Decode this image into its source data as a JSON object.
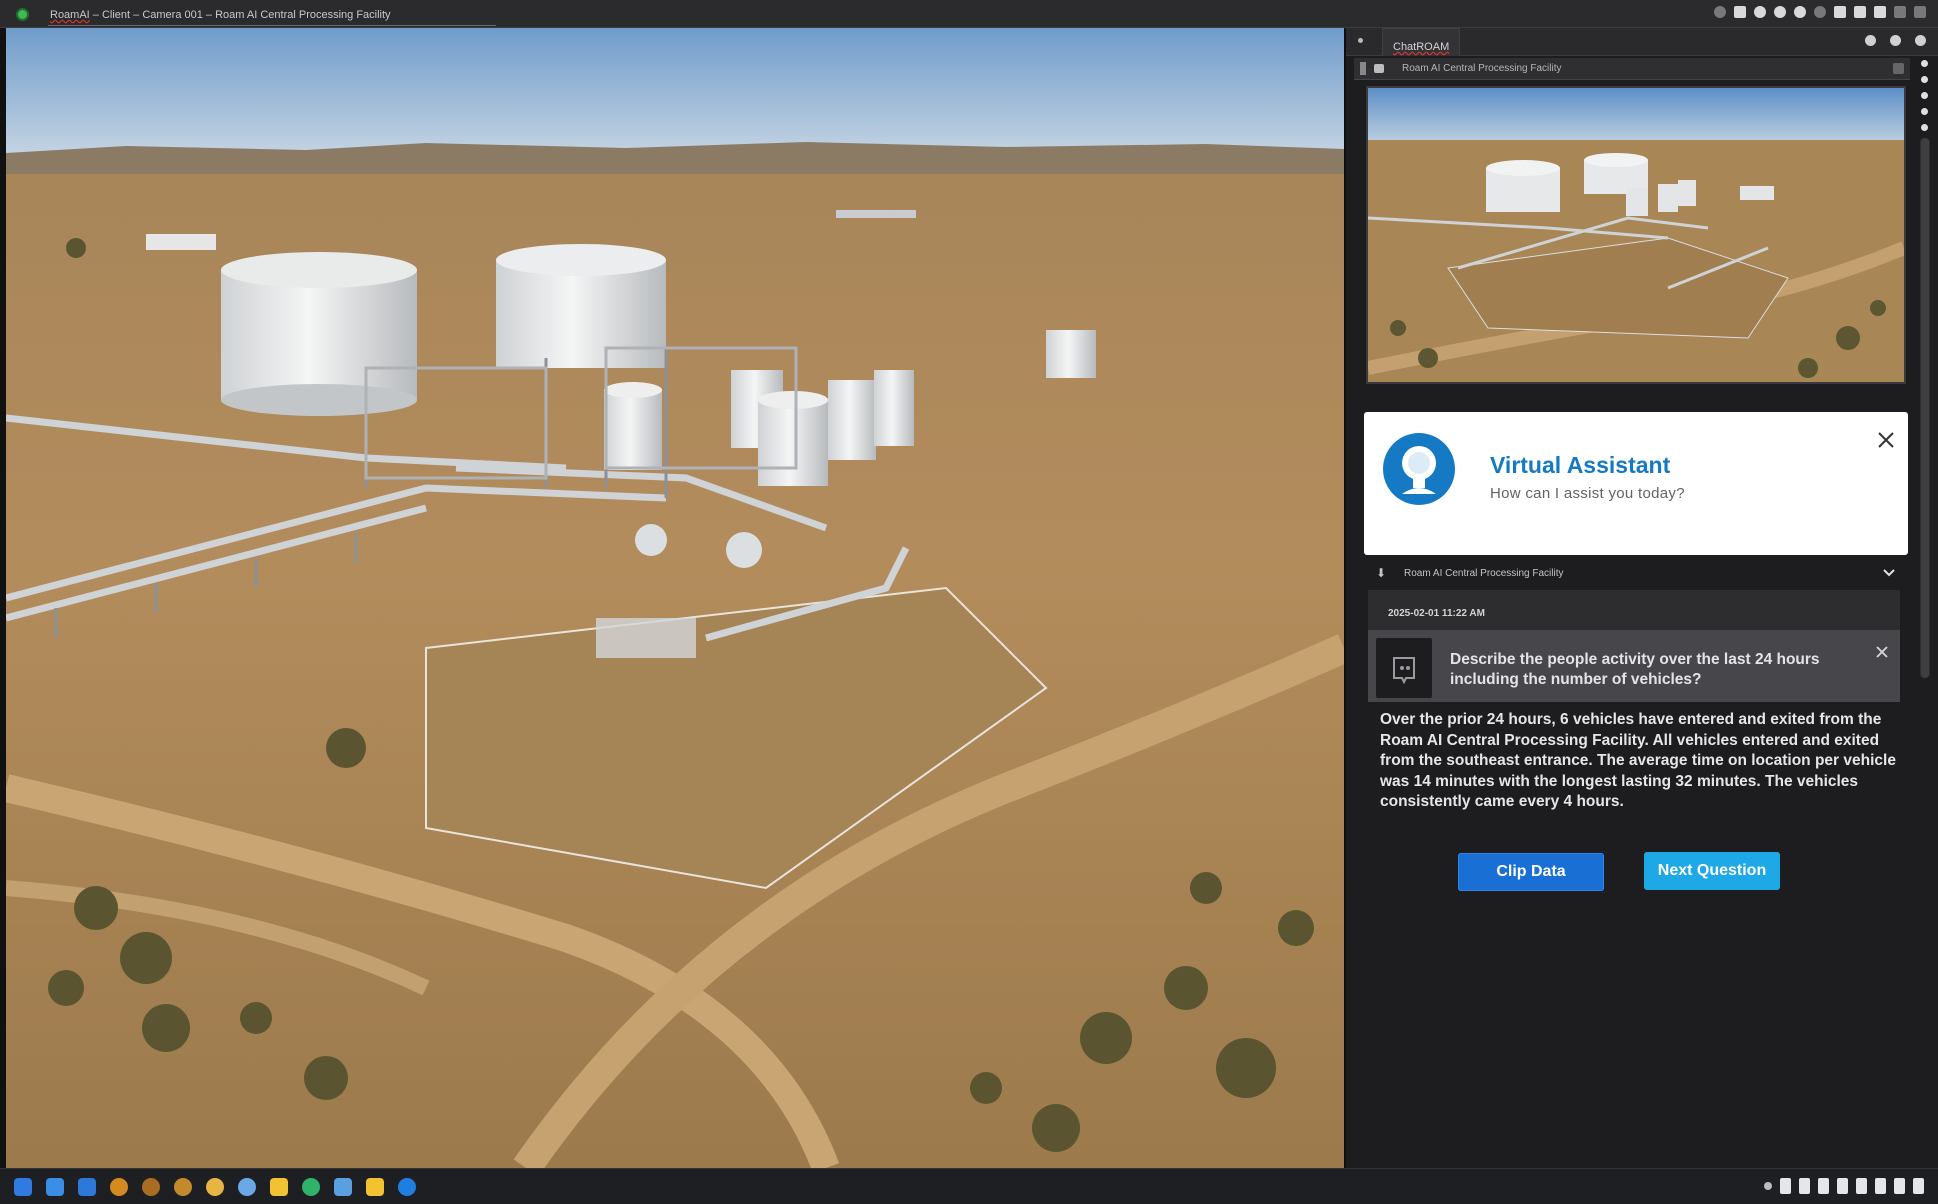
{
  "window": {
    "brand": "RoamAI",
    "title_rest": " – Client – Camera 001 – Roam AI Central Processing Facility"
  },
  "panel": {
    "tab_label": "ChatROAM",
    "camera_label": "Roam AI Central Processing Facility"
  },
  "assistant": {
    "title": "Virtual Assistant",
    "subtitle": "How can I assist you today?"
  },
  "chat": {
    "site_label": "Roam AI Central Processing Facility",
    "timestamp": "2025-02-01 11:22 AM",
    "question": "Describe the people activity over the last 24 hours including the number of vehicles?",
    "answer": "Over the prior 24 hours, 6 vehicles have entered and exited from the Roam AI Central Processing Facility.  All vehicles entered and exited from the southeast entrance.  The average time on location per vehicle was 14 minutes with the longest lasting 32 minutes. The vehicles consistently came every 4 hours."
  },
  "buttons": {
    "clip_data": "Clip Data",
    "next_question": "Next Question"
  },
  "icons": {
    "app": "roamai-app-icon",
    "assistant": "assistant-avatar-icon",
    "question": "assistant-face-icon"
  },
  "colors": {
    "accent_blue": "#1679c4",
    "clip_button": "#1a6fd4",
    "next_button": "#1ea8e6",
    "panel_bg": "#1d1d1f"
  }
}
